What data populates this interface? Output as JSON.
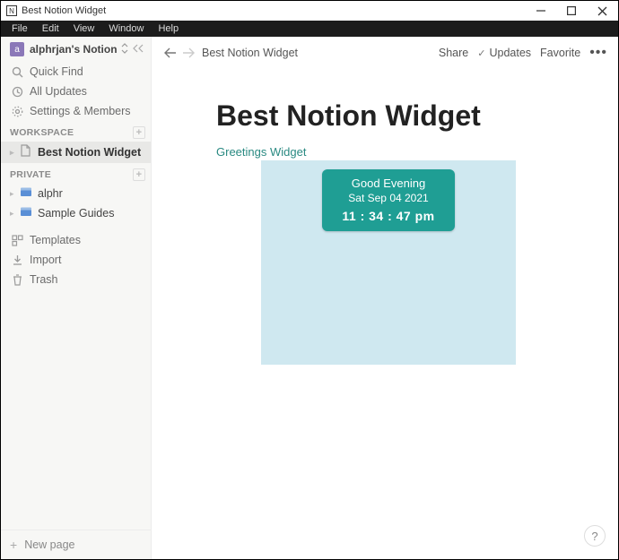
{
  "window": {
    "title": "Best Notion Widget"
  },
  "menubar": [
    "File",
    "Edit",
    "View",
    "Window",
    "Help"
  ],
  "sidebar": {
    "workspace": {
      "initial": "a",
      "name": "alphrjan's Notion"
    },
    "quick": [
      {
        "label": "Quick Find"
      },
      {
        "label": "All Updates"
      },
      {
        "label": "Settings & Members"
      }
    ],
    "sections": {
      "workspace_label": "WORKSPACE",
      "workspace_pages": [
        {
          "label": "Best Notion Widget"
        }
      ],
      "private_label": "PRIVATE",
      "private_pages": [
        {
          "label": "alphr"
        },
        {
          "label": "Sample Guides"
        }
      ]
    },
    "tools": [
      {
        "label": "Templates"
      },
      {
        "label": "Import"
      },
      {
        "label": "Trash"
      }
    ],
    "newpage": "New page"
  },
  "topbar": {
    "breadcrumb": "Best Notion Widget",
    "share": "Share",
    "updates": "Updates",
    "favorite": "Favorite"
  },
  "page": {
    "title": "Best Notion Widget",
    "widget_label": "Greetings Widget",
    "widget": {
      "greeting": "Good Evening",
      "date": "Sat Sep 04 2021",
      "time": "11  :  34  : 47 pm"
    }
  },
  "help": "?"
}
